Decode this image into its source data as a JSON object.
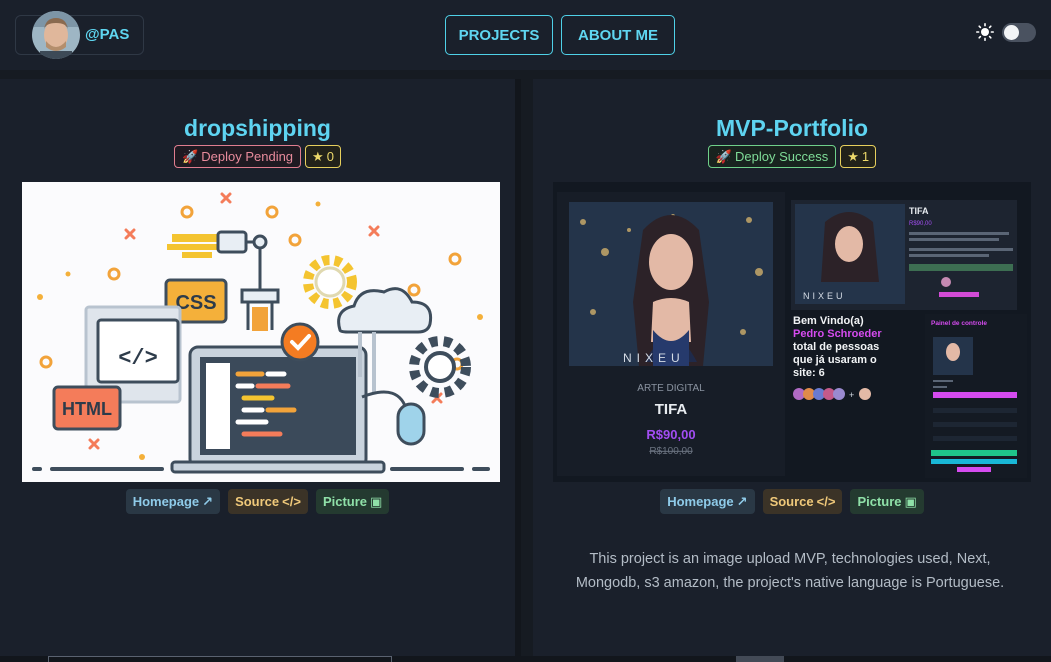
{
  "header": {
    "username": "@PAS",
    "nav": [
      {
        "label": "PROJECTS"
      },
      {
        "label": "ABOUT ME"
      }
    ]
  },
  "projects": [
    {
      "title": "dropshipping",
      "deploy_status": "Deploy Pending",
      "stars": "0",
      "links": {
        "homepage": "Homepage",
        "source": "Source",
        "picture": "Picture"
      },
      "image_text": {
        "css": "CSS",
        "html": "HTML"
      },
      "description": ""
    },
    {
      "title": "MVP-Portfolio",
      "deploy_status": "Deploy Success",
      "stars": "1",
      "links": {
        "homepage": "Homepage",
        "source": "Source",
        "picture": "Picture"
      },
      "image_text": {
        "brand": "NIXEU",
        "category": "ARTE DIGITAL",
        "product": "TIFA",
        "price": "R$90,00",
        "old_price": "R$100,00",
        "welcome": "Bem Vindo(a)",
        "user": "Pedro Schroeder",
        "total_line1": "total de pessoas",
        "total_line2": "que já usaram o",
        "total_line3": "site: 6",
        "panel_title": "Painel de controle",
        "side_title": "TIFA",
        "side_price": "R$90,00"
      },
      "description": "This project is an image upload MVP, technologies used, Next, Mongodb, s3 amazon, the project's native language is Portuguese."
    }
  ],
  "colors": {
    "accent": "#5fd6f1",
    "pending": "#e88b9c",
    "success": "#7fdc98",
    "star": "#ecd86a"
  }
}
